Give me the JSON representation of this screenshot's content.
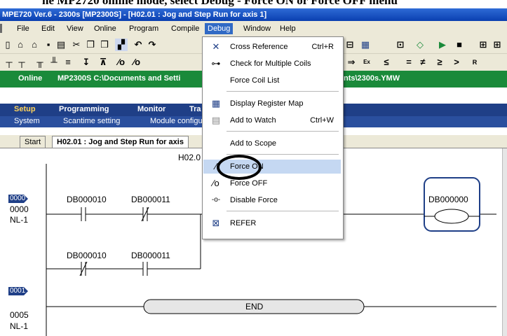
{
  "doc_header": {
    "text": "he MP2720 online mode, select Debug - Force ON or Force OFF menu"
  },
  "window": {
    "title": "MPE720 Ver.6 - 2300s [MP2300S] - [H02.01 : Jog and Step Run for axis 1]"
  },
  "menubar": {
    "items": [
      {
        "label": "File",
        "active": false
      },
      {
        "label": "Edit",
        "active": false
      },
      {
        "label": "View",
        "active": false
      },
      {
        "label": "Online",
        "active": false
      },
      {
        "label": "Program",
        "active": false
      },
      {
        "label": "Compile",
        "active": false
      },
      {
        "label": "Debug",
        "active": true
      },
      {
        "label": "Window",
        "active": false
      },
      {
        "label": "Help",
        "active": false
      }
    ]
  },
  "toolbar2": {
    "symbols": [
      "≤",
      "=",
      "≠",
      "≥",
      ">"
    ]
  },
  "status": {
    "mode": "Online",
    "path": "MP2300S C:\\Documents and Setti",
    "path_end": "nts\\2300s.YMW"
  },
  "nav": {
    "tabs": [
      "Setup",
      "Programming",
      "Monitor",
      "Tra"
    ],
    "subitems": [
      "System",
      "Scantime setting",
      "Module configu"
    ]
  },
  "doc_tabs": {
    "start": "Start",
    "current": "H02.01 : Jog and Step Run for axis"
  },
  "ladder": {
    "header": "H02.0",
    "rung0": {
      "num": "0000",
      "step": "0000",
      "nl": "NL-1"
    },
    "rung1": {
      "num": "0001",
      "step": "0005",
      "nl": "NL-1"
    },
    "contacts": [
      "DB000010",
      "DB000011",
      "DB000010",
      "DB000011"
    ],
    "coil": "DB000000",
    "end": "END"
  },
  "debug_menu": {
    "items": [
      {
        "label": "Cross Reference",
        "shortcut": "Ctrl+R",
        "icon": "cross-reference-icon",
        "glyph": "✕"
      },
      {
        "label": "Check for Multiple Coils",
        "shortcut": "",
        "icon": "check-coils-icon",
        "glyph": "⊶"
      },
      {
        "label": "Force Coil List",
        "shortcut": "",
        "icon": "",
        "glyph": ""
      },
      {
        "label": "Display Register Map",
        "shortcut": "",
        "icon": "register-map-icon",
        "glyph": "▦"
      },
      {
        "label": "Add to Watch",
        "shortcut": "Ctrl+W",
        "icon": "watch-icon",
        "glyph": "▤"
      },
      {
        "label": "Add to Scope",
        "shortcut": "",
        "icon": "",
        "glyph": ""
      },
      {
        "label": "Force ON",
        "shortcut": "",
        "icon": "force-on-icon",
        "glyph": "⁄",
        "highlighted": true
      },
      {
        "label": "Force OFF",
        "shortcut": "",
        "icon": "force-off-icon",
        "glyph": "∕o"
      },
      {
        "label": "Disable Force",
        "shortcut": "",
        "icon": "disable-force-icon",
        "glyph": "-o-"
      },
      {
        "label": "REFER",
        "shortcut": "",
        "icon": "refer-icon",
        "glyph": "⊠"
      }
    ]
  },
  "colors": {
    "status_green": "#1a8a3a",
    "nav_blue": "#1f3f87",
    "menu_highlight": "#316ac5",
    "coil_border": "#1f3f87"
  }
}
